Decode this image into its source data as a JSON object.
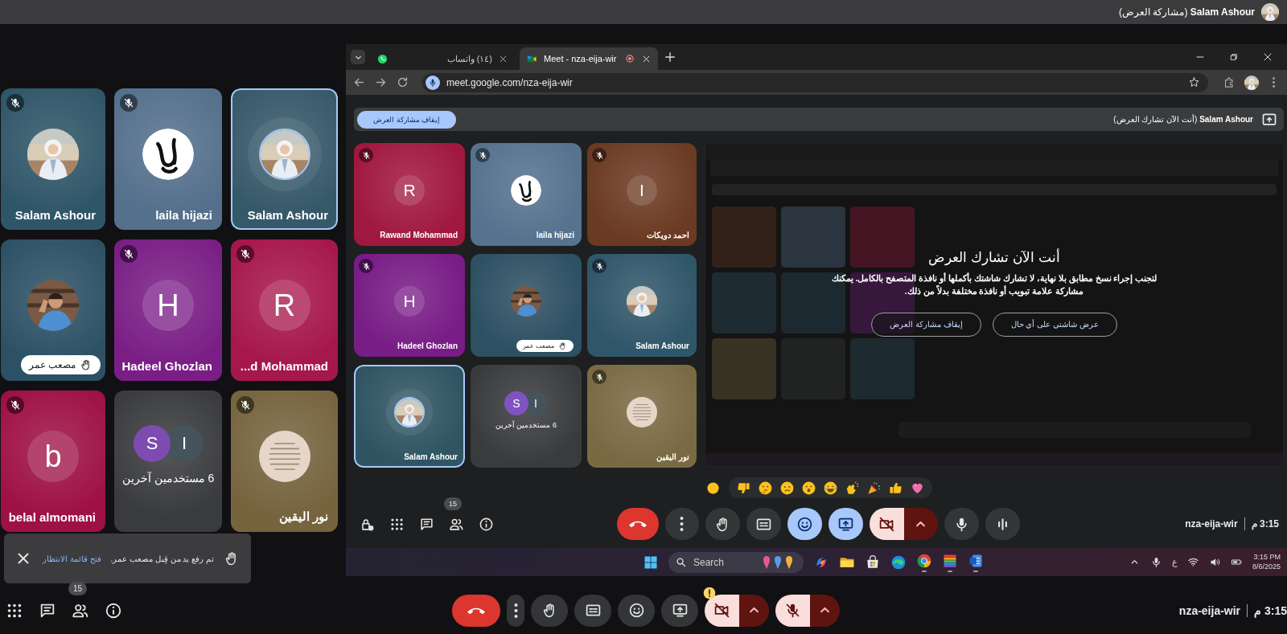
{
  "top_bar": {
    "presenter_status": "**Salam Ashour** (مشاركة العرض)"
  },
  "tiles": [
    {
      "name": "Salam Ashour",
      "color": "#36596a",
      "muted": false,
      "hand_raised": false,
      "highlighted": true
    },
    {
      "name": "laila hijazi",
      "kind": "logo",
      "color": "#55708c",
      "muted": true,
      "hand_raised": false,
      "highlighted": false
    },
    {
      "name": "Salam Ashour",
      "color": "#2f5668",
      "muted": true,
      "hand_raised": false,
      "highlighted": false
    },
    {
      "name": "...d Mohammad",
      "kind": "letter",
      "letter": "R",
      "color": "#a6174a",
      "muted": true,
      "hand_raised": false,
      "highlighted": false
    },
    {
      "name": "Hadeel Ghozlan",
      "kind": "letter",
      "letter": "H",
      "color": "#7a1e86",
      "muted": true,
      "hand_raised": false,
      "highlighted": false
    },
    {
      "name": "مصعب عمر",
      "color": "#2c5165",
      "muted": false,
      "hand_raised": true,
      "highlighted": false
    },
    {
      "name": "نور اليقين",
      "kind": "document",
      "color": "#76643e",
      "muted": true,
      "hand_raised": false,
      "highlighted": false
    },
    {
      "kind": "others",
      "text": "6 مستخدمين آخرين",
      "avatars": [
        {
          "letter": "I",
          "color": "#45545c"
        },
        {
          "letter": "S",
          "color": "#7e4cb0"
        }
      ],
      "color": "#3a3b3d",
      "muted": false,
      "hand_raised": false,
      "highlighted": false
    },
    {
      "name": "belal almomani",
      "kind": "letter",
      "letter": "b",
      "color": "#9e1144",
      "muted": true,
      "hand_raised": false,
      "highlighted": false
    }
  ],
  "toast": {
    "message": "تم رفع يد من قِبل مصعب عمر.",
    "link": "فتح قائمة الانتظار"
  },
  "bottom_bar": {
    "side_buttons": [
      {
        "kind": "apps"
      },
      {
        "kind": "chat"
      },
      {
        "kind": "people",
        "badge": "15"
      },
      {
        "kind": "info"
      }
    ],
    "controls": [
      {
        "kind": "end-call"
      },
      {
        "kind": "more"
      },
      {
        "kind": "hand",
        "on": false
      },
      {
        "kind": "captions",
        "on": false
      },
      {
        "kind": "emoji",
        "on": false
      },
      {
        "kind": "present",
        "on": false
      },
      {
        "kind": "camera",
        "on": false,
        "caret": true,
        "warning": true
      },
      {
        "kind": "mic",
        "on": false,
        "caret": true,
        "warning": false
      }
    ],
    "meeting_code": "nza-eija-wir",
    "time": "3:15 م"
  },
  "browser": {
    "tabs": [
      {
        "title": "Meet - nza-eija-wir",
        "kind": "meet",
        "selected": true,
        "recording": true
      },
      {
        "title": "(١٤) واتساب",
        "kind": "whatsapp",
        "selected": false,
        "recording": false
      }
    ],
    "url": "meet.google.com/nza-eija-wir",
    "meet": {
      "banner": {
        "text": "**Salam Ashour** (أنت الآن تشارك العرض)",
        "button": "إيقاف مشاركة العرض"
      },
      "tiles": [
        {
          "name": "احمد دويكات",
          "kind": "letter",
          "letter": "I",
          "color": "#6b3a22",
          "muted": true,
          "hand_raised": false,
          "highlighted": false
        },
        {
          "name": "laila hijazi",
          "kind": "logo",
          "color": "#56728e",
          "muted": true,
          "hand_raised": false,
          "highlighted": false
        },
        {
          "name": "Rawand Mohammad",
          "kind": "letter",
          "letter": "R",
          "color": "#a0183f",
          "muted": true,
          "hand_raised": false,
          "highlighted": false
        },
        {
          "name": "Salam Ashour",
          "color": "#30566a",
          "muted": true,
          "hand_raised": false,
          "highlighted": false
        },
        {
          "name": "مصعب عمر",
          "color": "#2d5063",
          "muted": false,
          "hand_raised": true,
          "highlighted": false
        },
        {
          "name": "Hadeel Ghozlan",
          "kind": "letter",
          "letter": "H",
          "color": "#781c86",
          "muted": true,
          "hand_raised": false,
          "highlighted": false
        },
        {
          "name": "نور اليقين",
          "kind": "document",
          "color": "#7a6a44",
          "muted": true,
          "hand_raised": false,
          "highlighted": false
        },
        {
          "kind": "others",
          "text": "6 مستخدمين آخرين",
          "avatars": [
            {
              "letter": "I",
              "color": "#45545c"
            },
            {
              "letter": "S",
              "color": "#8152c2"
            }
          ],
          "color": "#3a3b3d",
          "muted": false,
          "hand_raised": false,
          "highlighted": false
        },
        {
          "name": "Salam Ashour",
          "color": "#2f5462",
          "muted": false,
          "hand_raised": false,
          "highlighted": true
        }
      ],
      "share_warning": {
        "title": "أنت الآن تشارك العرض",
        "message": "لتجنب إجراء نسخ مطابق بلا نهاية، لا تشارك شاشتك بأكملها أو نافذة المتصفح بالكامل. يمكنك مشاركة علامة تبويب أو نافذة مختلفة بدلاً من ذلك.",
        "buttons": [
          "عرض شاشتي على أي حال",
          "إيقاف مشاركة العرض"
        ]
      },
      "reactions": [
        {
          "kind": "tone"
        },
        {
          "kind": "thumbs-down"
        },
        {
          "kind": "thinking"
        },
        {
          "kind": "crying"
        },
        {
          "kind": "surprised"
        },
        {
          "kind": "laughing"
        },
        {
          "kind": "clapping"
        },
        {
          "kind": "party"
        },
        {
          "kind": "thumbs-up"
        },
        {
          "kind": "heart"
        }
      ],
      "side_buttons": [
        {
          "kind": "host-controls"
        },
        {
          "kind": "apps"
        },
        {
          "kind": "chat"
        },
        {
          "kind": "people",
          "badge": "15"
        },
        {
          "kind": "info"
        }
      ],
      "controls": [
        {
          "kind": "end-call"
        },
        {
          "kind": "more"
        },
        {
          "kind": "hand",
          "on": false
        },
        {
          "kind": "captions",
          "on": false
        },
        {
          "kind": "emoji",
          "on": true
        },
        {
          "kind": "present",
          "on": true
        },
        {
          "kind": "camera",
          "on": false,
          "caret": true,
          "warning": false
        },
        {
          "kind": "mic",
          "on": true,
          "caret": false,
          "warning": false
        },
        {
          "kind": "audio"
        }
      ],
      "meeting_code": "nza-eija-wir",
      "time": "3:15 م"
    }
  },
  "taskbar": {
    "search": {
      "placeholder": "Search"
    },
    "apps": [
      {
        "kind": "swirl",
        "running": false
      },
      {
        "kind": "folder",
        "running": false
      },
      {
        "kind": "store",
        "running": false
      },
      {
        "kind": "wave",
        "running": false
      },
      {
        "kind": "ring",
        "running": true
      },
      {
        "kind": "stack",
        "running": true
      },
      {
        "kind": "document",
        "running": true
      }
    ],
    "language": "ع",
    "time": "3:15 PM",
    "date": "8/6/2025"
  }
}
